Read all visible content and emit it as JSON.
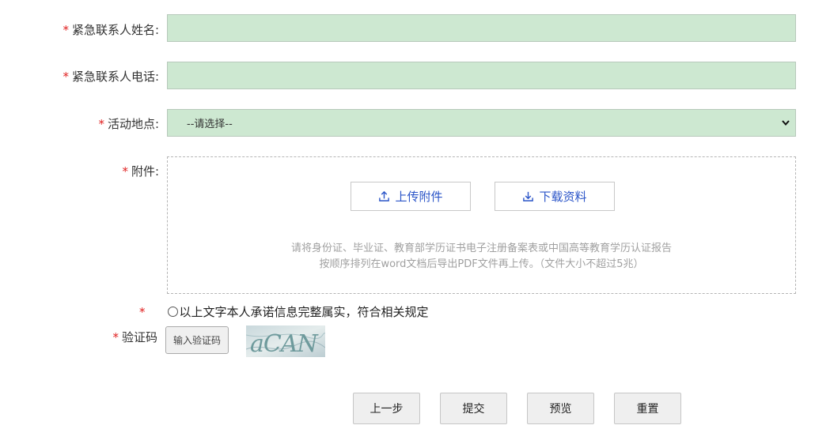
{
  "form": {
    "required_mark": "*",
    "emergency_name_label": "紧急联系人姓名:",
    "emergency_name_value": "",
    "emergency_phone_label": "紧急联系人电话:",
    "emergency_phone_value": "",
    "location_label": "活动地点:",
    "location_selected": "--请选择--",
    "attachment_label": "附件:",
    "upload_button": "上传附件",
    "download_button": "下载资料",
    "hint_line1": "请将身份证、毕业证、教育部学历证书电子注册备案表或中国高等教育学历认证报告",
    "hint_line2": "按顺序排列在word文档后导出PDF文件再上传。（文件大小不超过5兆）",
    "promise_text": "以上文字本人承诺信息完整属实，符合相关规定",
    "captcha_label": "验证码",
    "captcha_placeholder": "输入验证码",
    "captcha_code": "aCAN"
  },
  "actions": {
    "prev": "上一步",
    "submit": "提交",
    "preview": "预览",
    "reset": "重置"
  },
  "colors": {
    "input_bg": "#cde8d1",
    "required": "#e02020",
    "link_blue": "#2b55c8"
  }
}
